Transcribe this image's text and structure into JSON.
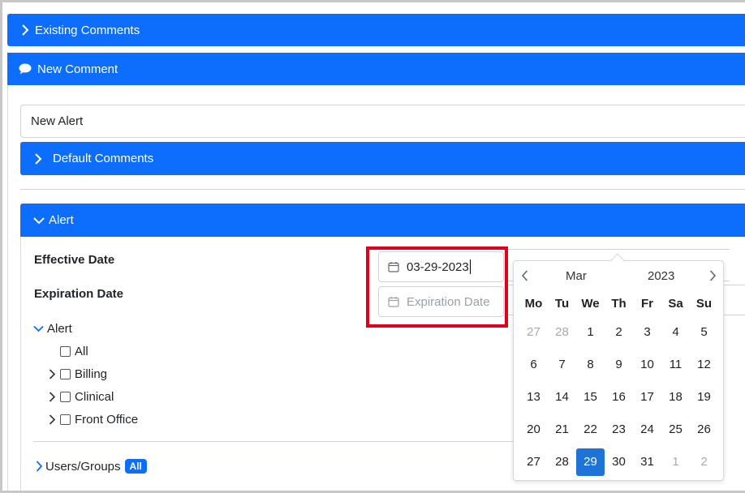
{
  "panels": {
    "existing_comments": "Existing Comments",
    "new_comment": "New Comment"
  },
  "subject_value": "New Alert",
  "default_comments": "Default Comments",
  "alert_section": "Alert",
  "fields": {
    "effective_label": "Effective Date",
    "effective_value": "03-29-2023",
    "expiration_label": "Expiration Date",
    "expiration_placeholder": "Expiration Date"
  },
  "tree": {
    "root": "Alert",
    "all": "All",
    "billing": "Billing",
    "clinical": "Clinical",
    "front_office": "Front Office"
  },
  "users_groups": {
    "label": "Users/Groups",
    "badge": "All"
  },
  "datepicker": {
    "month": "Mar",
    "year": "2023",
    "weekdays": [
      "Mo",
      "Tu",
      "We",
      "Th",
      "Fr",
      "Sa",
      "Su"
    ],
    "weeks": [
      [
        "27",
        "28",
        "1",
        "2",
        "3",
        "4",
        "5"
      ],
      [
        "6",
        "7",
        "8",
        "9",
        "10",
        "11",
        "12"
      ],
      [
        "13",
        "14",
        "15",
        "16",
        "17",
        "18",
        "19"
      ],
      [
        "20",
        "21",
        "22",
        "23",
        "24",
        "25",
        "26"
      ],
      [
        "27",
        "28",
        "29",
        "30",
        "31",
        "1",
        "2"
      ]
    ],
    "muted": [
      [
        0,
        0
      ],
      [
        0,
        1
      ],
      [
        4,
        5
      ],
      [
        4,
        6
      ]
    ],
    "selected": [
      4,
      2
    ]
  },
  "colors": {
    "primary": "#0d6efd",
    "highlight": "#e0001b",
    "selected_day": "#1e73d8"
  }
}
